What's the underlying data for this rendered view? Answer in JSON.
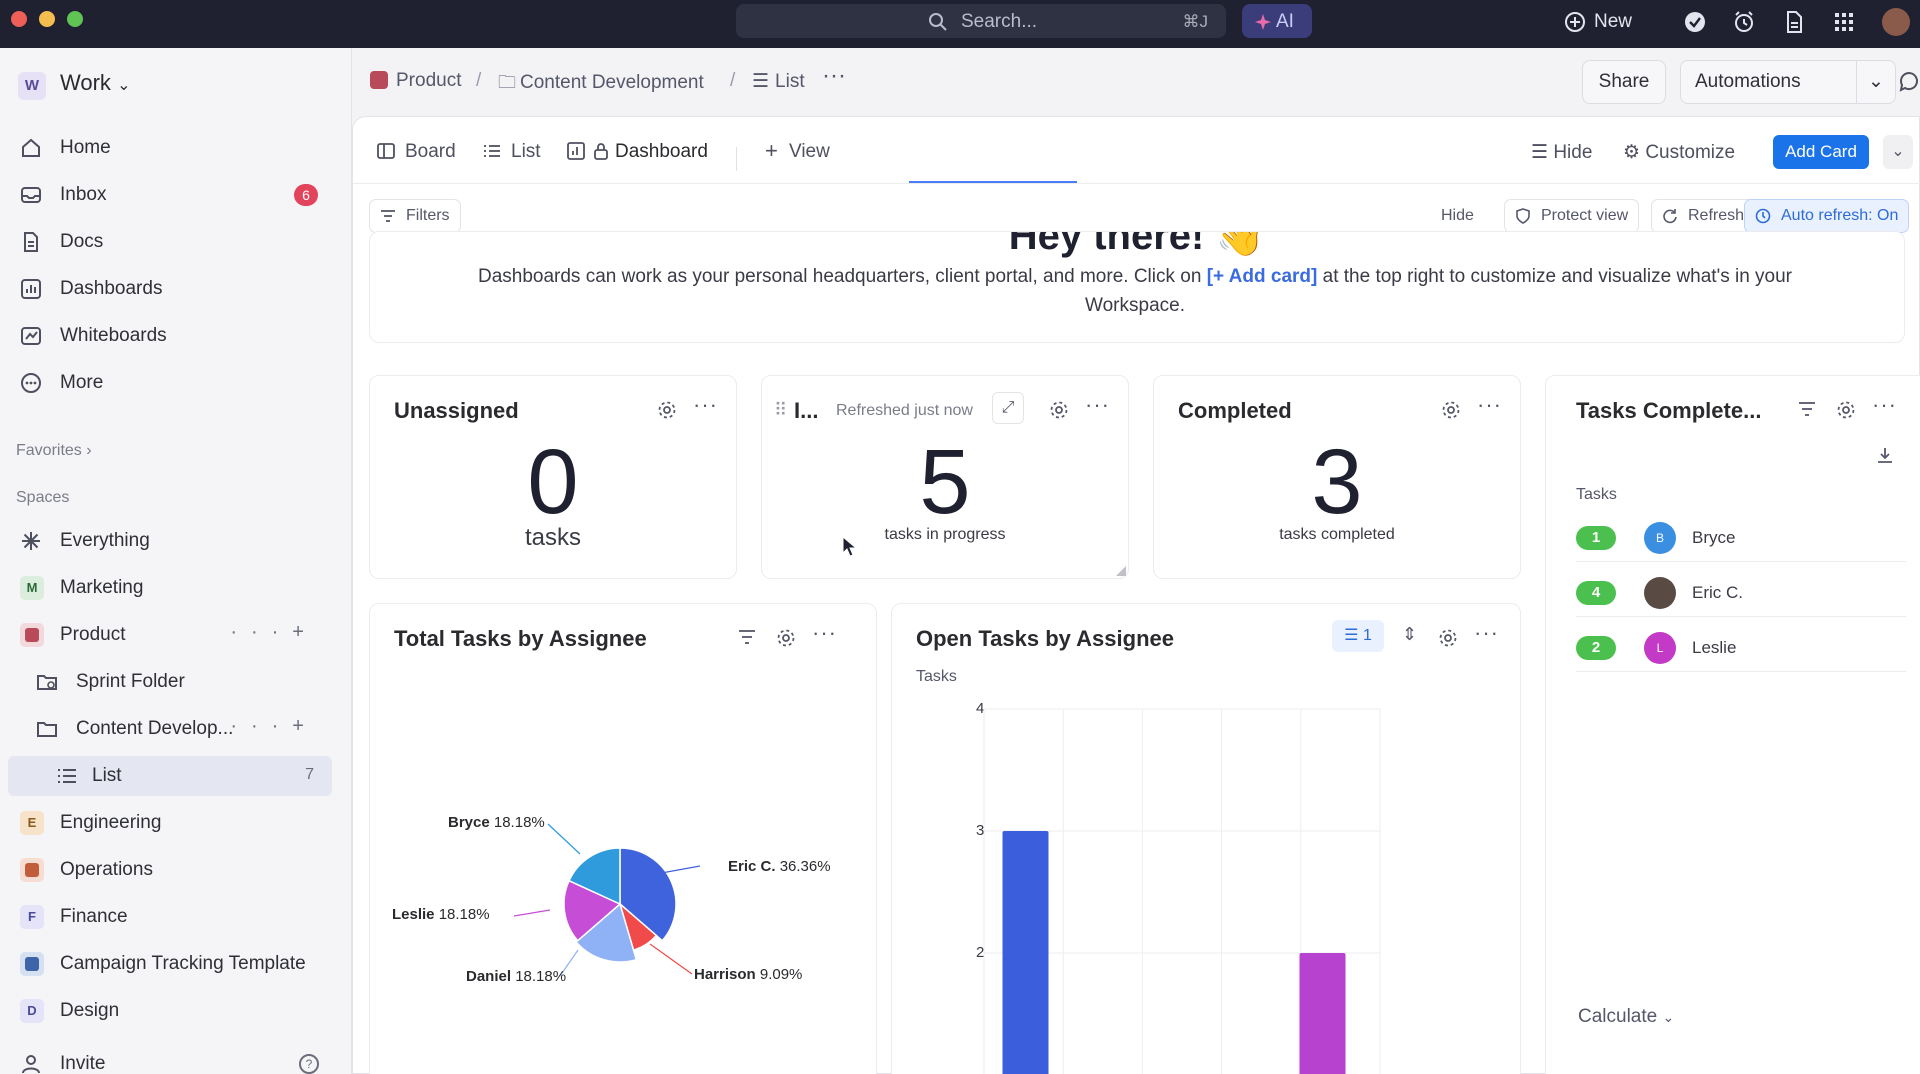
{
  "topbar": {
    "search_placeholder": "Search...",
    "shortcut": "⌘J",
    "ai_label": "AI",
    "new_label": "New"
  },
  "sidebar": {
    "workspace_initial": "W",
    "workspace_name": "Work",
    "nav": [
      {
        "label": "Home",
        "icon": "home-icon"
      },
      {
        "label": "Inbox",
        "icon": "inbox-icon",
        "badge": "6"
      },
      {
        "label": "Docs",
        "icon": "docs-icon"
      },
      {
        "label": "Dashboards",
        "icon": "dashboards-icon"
      },
      {
        "label": "Whiteboards",
        "icon": "whiteboards-icon"
      },
      {
        "label": "More",
        "icon": "more-icon"
      }
    ],
    "favorites_label": "Favorites",
    "spaces_label": "Spaces",
    "spaces": [
      {
        "label": "Everything",
        "icon": "everything-icon"
      },
      {
        "label": "Marketing",
        "initial": "M",
        "color": "#dbeede"
      },
      {
        "label": "Product",
        "initial": "",
        "color": "#b94a5a"
      },
      {
        "label": "Sprint Folder",
        "icon": "sprint-folder-icon"
      },
      {
        "label": "Content Develop...",
        "icon": "folder-icon"
      },
      {
        "label": "List",
        "icon": "list-icon",
        "count": "7"
      },
      {
        "label": "Engineering",
        "initial": "E",
        "color": "#f6e3c9"
      },
      {
        "label": "Operations",
        "initial": "",
        "color": "#c25d3b"
      },
      {
        "label": "Finance",
        "initial": "F",
        "color": "#e4e3f7"
      },
      {
        "label": "Campaign Tracking Template",
        "initial": "",
        "color": "#3d63a8"
      },
      {
        "label": "Design",
        "initial": "D",
        "color": "#e4e3f7"
      }
    ],
    "invite_label": "Invite"
  },
  "breadcrumb": {
    "items": [
      "Product",
      "Content Development",
      "List"
    ],
    "share_label": "Share",
    "automations_label": "Automations"
  },
  "views": {
    "tabs": [
      "Board",
      "List",
      "Dashboard",
      "View"
    ],
    "active": "Dashboard",
    "hide_label": "Hide",
    "customize_label": "Customize",
    "add_card_label": "Add Card"
  },
  "toolbar": {
    "filters_label": "Filters",
    "hide_label": "Hide",
    "protect_label": "Protect view",
    "refreshed_label": "Refreshed: just now",
    "auto_refresh_label": "Auto refresh: On"
  },
  "welcome": {
    "title": "Hey there! 👋",
    "text_before": "Dashboards can work as your personal headquarters, client portal, and more. Click on ",
    "link": "[+ Add card]",
    "text_after": " at the top right to customize and visualize what's in your Workspace."
  },
  "cards": {
    "unassigned": {
      "title": "Unassigned",
      "value": "0",
      "caption": "tasks"
    },
    "in_progress": {
      "title": "I...",
      "refreshed": "Refreshed just now",
      "value": "5",
      "caption": "tasks in progress"
    },
    "completed": {
      "title": "Completed",
      "value": "3",
      "caption": "tasks completed"
    },
    "leaderboard": {
      "title": "Tasks Complete...",
      "column_label": "Tasks",
      "rows": [
        {
          "count": "1",
          "initial": "B",
          "name": "Bryce",
          "color": "#3a8fe0"
        },
        {
          "count": "4",
          "initial": "",
          "name": "Eric C.",
          "color": "#5a4a44"
        },
        {
          "count": "2",
          "initial": "L",
          "name": "Leslie",
          "color": "#c33ac7"
        }
      ],
      "calculate_label": "Calculate"
    }
  },
  "pie_card": {
    "title": "Total Tasks by Assignee",
    "chart_data": {
      "type": "pie",
      "slices": [
        {
          "label": "Eric C.",
          "pct": "36.36%",
          "value": 36.36,
          "color": "#3f63dd"
        },
        {
          "label": "Harrison",
          "pct": "9.09%",
          "value": 9.09,
          "color": "#f04a4a"
        },
        {
          "label": "Daniel",
          "pct": "18.18%",
          "value": 18.18,
          "color": "#8fb1f5"
        },
        {
          "label": "Leslie",
          "pct": "18.18%",
          "value": 18.18,
          "color": "#c64dd6"
        },
        {
          "label": "Bryce",
          "pct": "18.18%",
          "value": 18.18,
          "color": "#2f9bdc"
        }
      ]
    }
  },
  "bar_card": {
    "title": "Open Tasks by Assignee",
    "filter_count": "1",
    "chart_data": {
      "type": "bar",
      "ylabel": "Tasks",
      "yticks": [
        "4",
        "3",
        "2"
      ],
      "ylim": [
        0,
        4
      ],
      "values": [
        3,
        0,
        0,
        2
      ],
      "colors": [
        "#3b5fdc",
        "#3b5fdc",
        "#3b5fdc",
        "#b642cf"
      ]
    }
  }
}
